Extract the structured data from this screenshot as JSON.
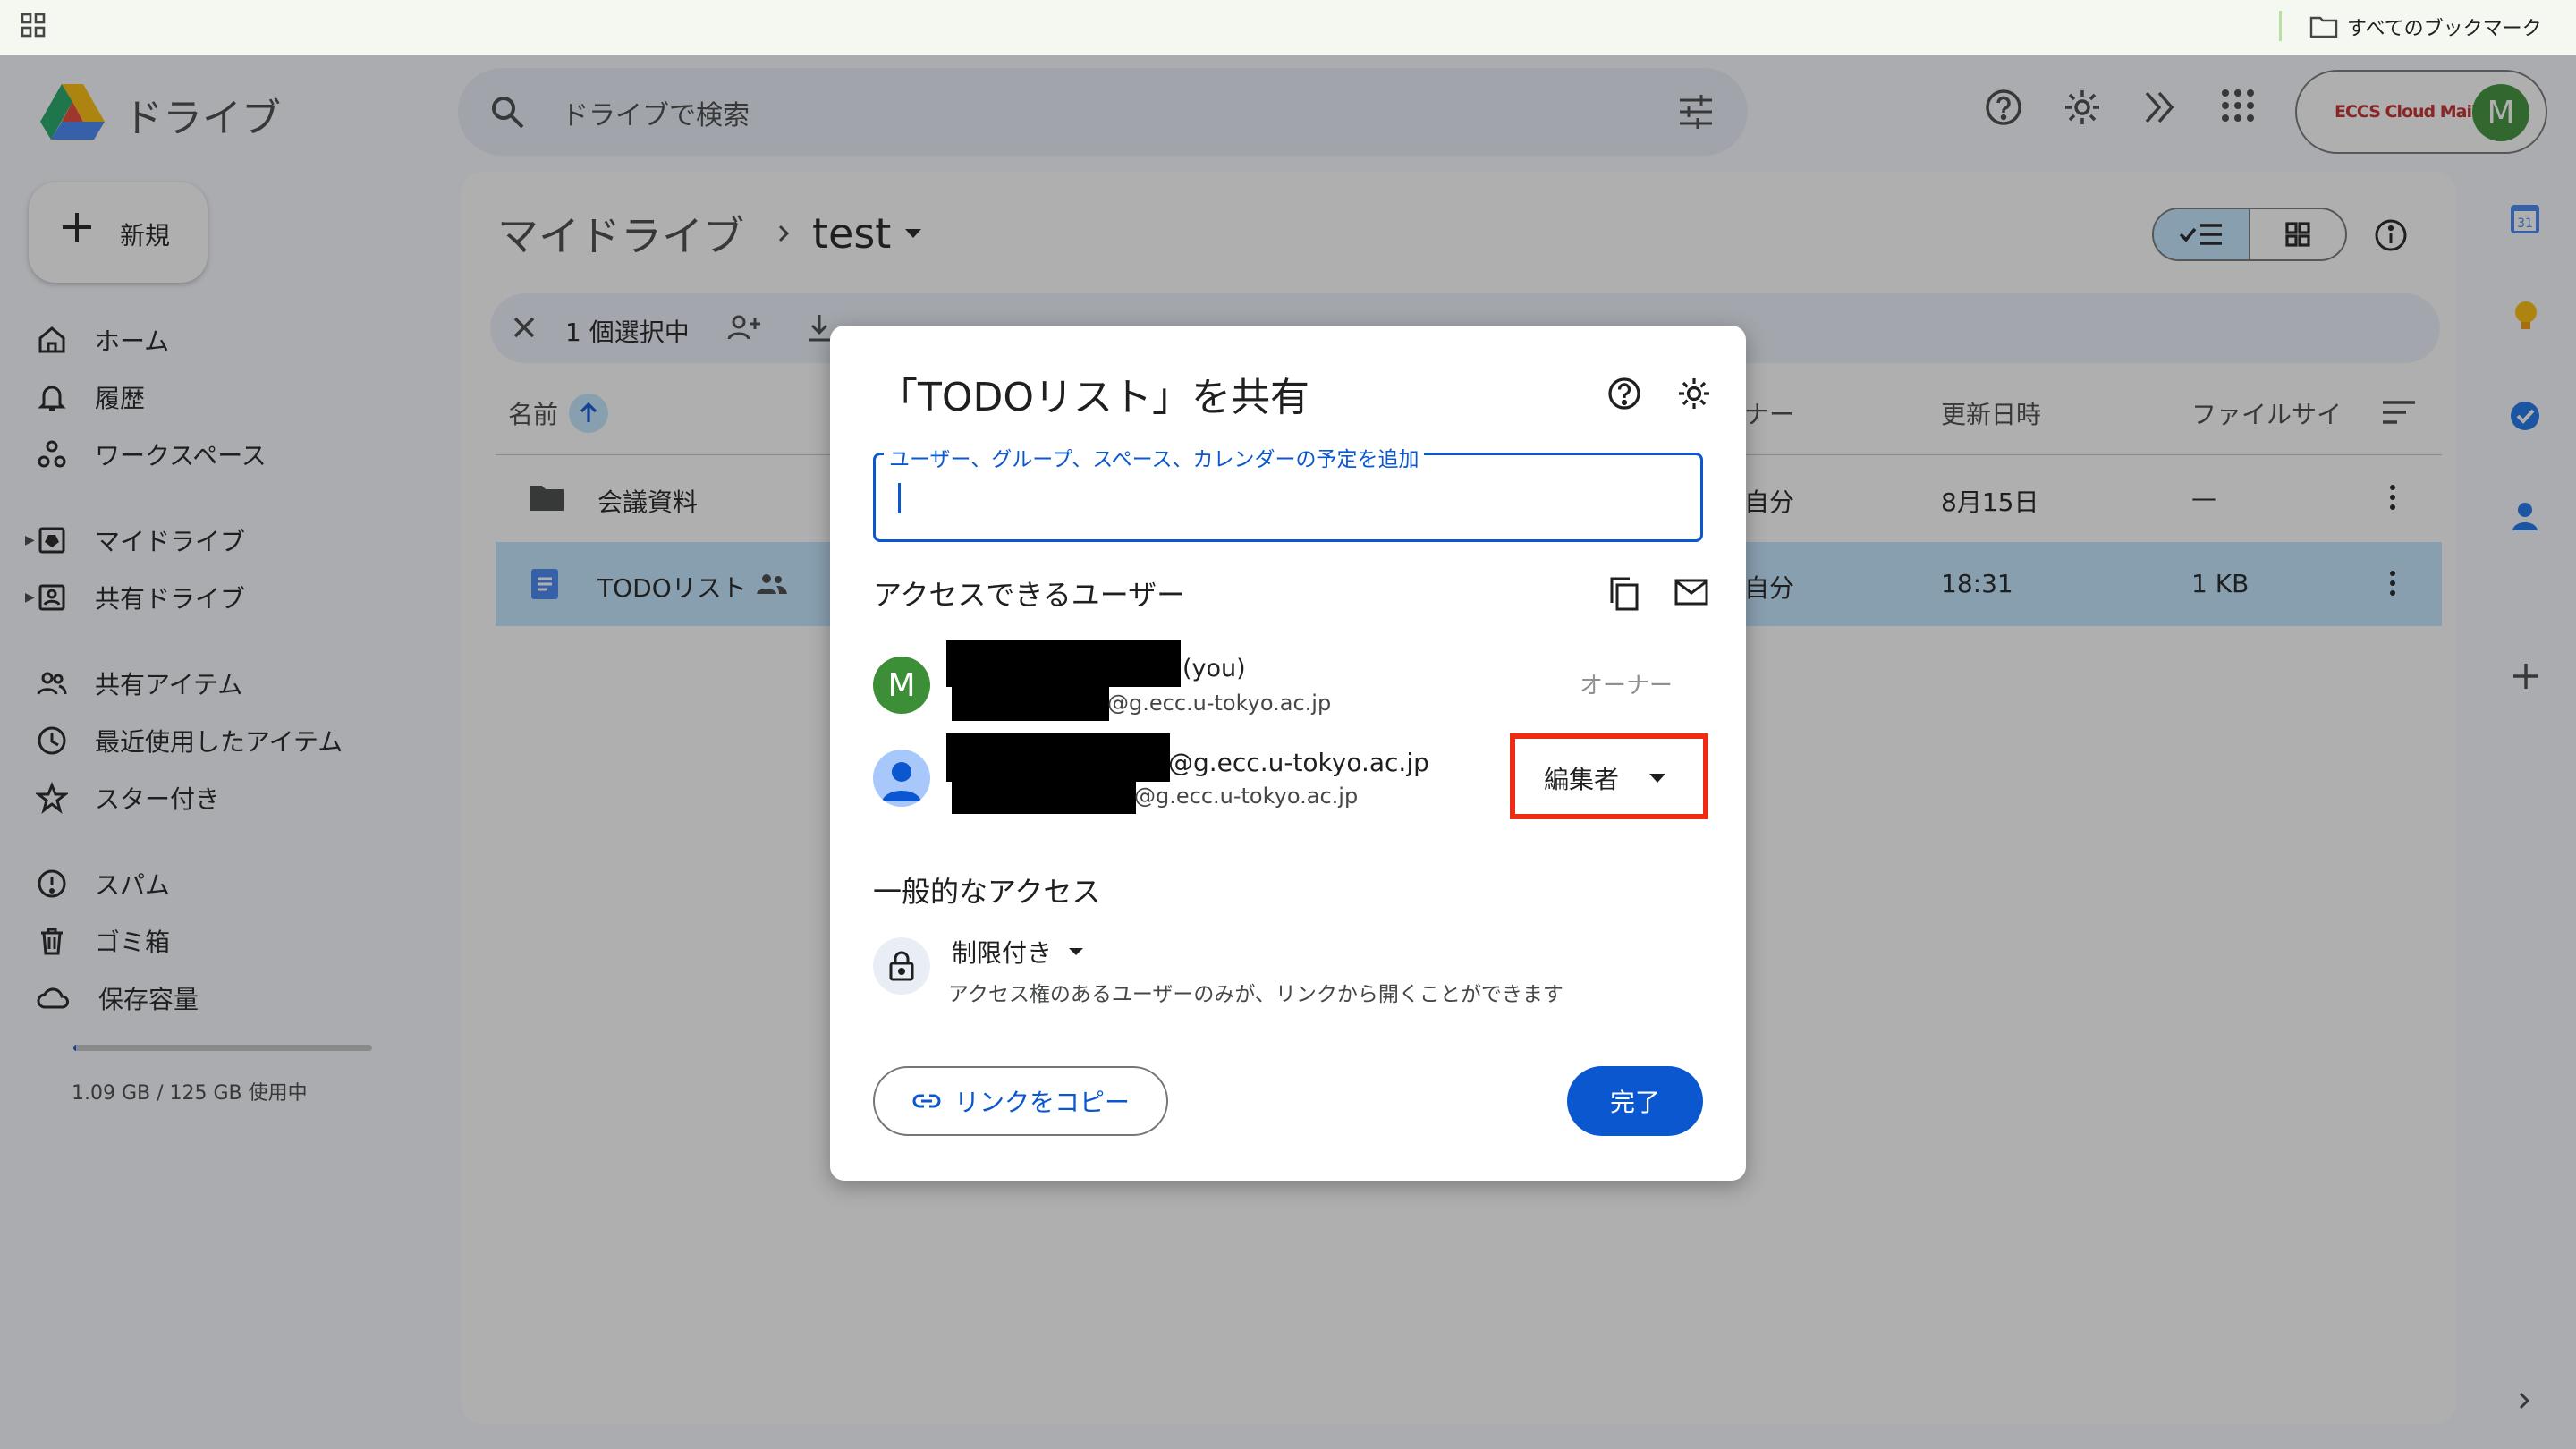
{
  "bookmarks": {
    "all_label": "すべてのブックマーク"
  },
  "drive": {
    "brand": "ドライブ",
    "search_placeholder": "ドライブで検索",
    "account_logo_text": "ECCS Cloud Mail",
    "account_initial": "M"
  },
  "sidebar": {
    "new_label": "新規",
    "items": [
      {
        "label": "ホーム",
        "icon": "home-icon"
      },
      {
        "label": "履歴",
        "icon": "bell-icon"
      },
      {
        "label": "ワークスペース",
        "icon": "workspace-icon"
      },
      {
        "label": "マイドライブ",
        "icon": "my-drive-icon"
      },
      {
        "label": "共有ドライブ",
        "icon": "shared-drive-icon"
      },
      {
        "label": "共有アイテム",
        "icon": "shared-people-icon"
      },
      {
        "label": "最近使用したアイテム",
        "icon": "clock-icon"
      },
      {
        "label": "スター付き",
        "icon": "star-icon"
      },
      {
        "label": "スパム",
        "icon": "spam-icon"
      },
      {
        "label": "ゴミ箱",
        "icon": "trash-icon"
      },
      {
        "label": "保存容量",
        "icon": "cloud-icon"
      }
    ],
    "storage_text": "1.09 GB / 125 GB 使用中",
    "storage_fraction": 0.0087
  },
  "main": {
    "breadcrumb_root": "マイドライブ",
    "breadcrumb_current": "test",
    "selection_count": "1 個選択中",
    "columns": {
      "name": "名前",
      "owner": "ナー",
      "modified": "更新日時",
      "size": "ファイルサイ"
    },
    "rows": [
      {
        "name": "会議資料",
        "owner": "自分",
        "modified": "8月15日",
        "size": "—"
      },
      {
        "name": "TODOリスト",
        "owner": "自分",
        "modified": "18:31",
        "size": "1 KB"
      }
    ]
  },
  "dialog": {
    "title": "「TODOリスト」を共有",
    "input_label": "ユーザー、グループ、スペース、カレンダーの予定を追加",
    "people_heading": "アクセスできるユーザー",
    "people": [
      {
        "initial": "M",
        "name_suffix": "(you)",
        "email": "@g.ecc.u-tokyo.ac.jp",
        "role": "オーナー"
      },
      {
        "name_suffix": "@g.ecc.u-tokyo.ac.jp",
        "email": "@g.ecc.u-tokyo.ac.jp",
        "role": "編集者"
      }
    ],
    "general_heading": "一般的なアクセス",
    "access_level": "制限付き",
    "access_desc": "アクセス権のあるユーザーのみが、リンクから開くことができます",
    "copy_link": "リンクをコピー",
    "done": "完了"
  },
  "colors": {
    "accent": "#0b57d0",
    "selected_row": "#c2e7ff",
    "highlight_box": "#ee2b14"
  }
}
